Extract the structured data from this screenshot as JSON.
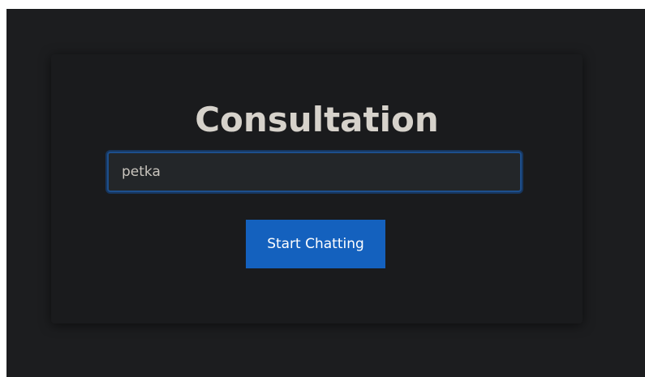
{
  "page": {
    "background": "#1c1d1f",
    "card_background": "#1a1b1d"
  },
  "form": {
    "title": "Consultation",
    "name_input": {
      "value": "petka",
      "placeholder": ""
    },
    "submit_label": "Start Chatting",
    "accent_color": "#1461be",
    "focus_border_color": "#1d4f8c"
  }
}
